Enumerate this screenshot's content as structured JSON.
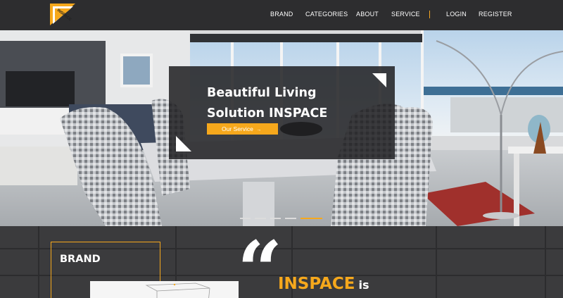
{
  "brand": {
    "logo_text": "INSPACE",
    "accent_color": "#f6a81c"
  },
  "nav": {
    "items": [
      {
        "label": "BRAND"
      },
      {
        "label": "CATEGORIES"
      },
      {
        "label": "ABOUT"
      },
      {
        "label": "SERVICE"
      },
      {
        "label": "LOGIN"
      },
      {
        "label": "REGISTER"
      }
    ],
    "separator": "|"
  },
  "hero": {
    "title_line1": "Beautiful Living",
    "title_line2": "Solution INSPACE",
    "cta_label": "Our Service",
    "cta_icon": "arrow-right-icon",
    "slides_total": 5,
    "slide_active": 5
  },
  "brand_section": {
    "label": "BRAND"
  },
  "about_section": {
    "quote_glyph": "“",
    "highlight": "INSPACE",
    "text_after": "is"
  }
}
